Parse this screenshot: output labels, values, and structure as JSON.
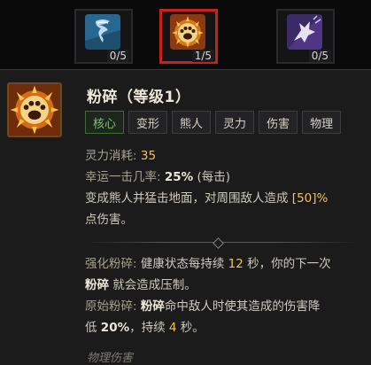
{
  "slots": [
    {
      "name": "cyclone",
      "count": "0/5",
      "selected": false
    },
    {
      "name": "pulverize",
      "count": "1/5",
      "selected": true
    },
    {
      "name": "wolf",
      "count": "0/5",
      "selected": false
    }
  ],
  "skill": {
    "title": "粉碎（等级1）",
    "tags": [
      "核心",
      "变形",
      "熊人",
      "灵力",
      "伤害",
      "物理"
    ],
    "cost_label": "灵力消耗:",
    "cost_value": "35",
    "lucky_label": "幸运一击几率:",
    "lucky_value": "25%",
    "lucky_suffix": "(每击)",
    "desc_line1_a": "变成熊人并猛击地面，对周围敌人造成 ",
    "desc_line1_b": "[50]%",
    "desc_line2": "点伤害。",
    "enh_label": "强化粉碎:",
    "enh_a": "健康状态每持续 ",
    "enh_num": "12",
    "enh_b": " 秒，你的下一次",
    "enh_c_bold": "粉碎",
    "enh_c": " 就会造成压制。",
    "prim_label": "原始粉碎:",
    "prim_bold": "粉碎",
    "prim_a": "命中敌人时使其造成的伤害降",
    "prim_b": "低 ",
    "prim_num1": "20%",
    "prim_c": "，持续 ",
    "prim_num2": "4",
    "prim_d": " 秒。",
    "footer": "物理伤害"
  },
  "colors": {
    "accent_red": "#c8201a",
    "highlight_yellow": "#f0c25a",
    "core_tag_green": "#7fc37a"
  }
}
